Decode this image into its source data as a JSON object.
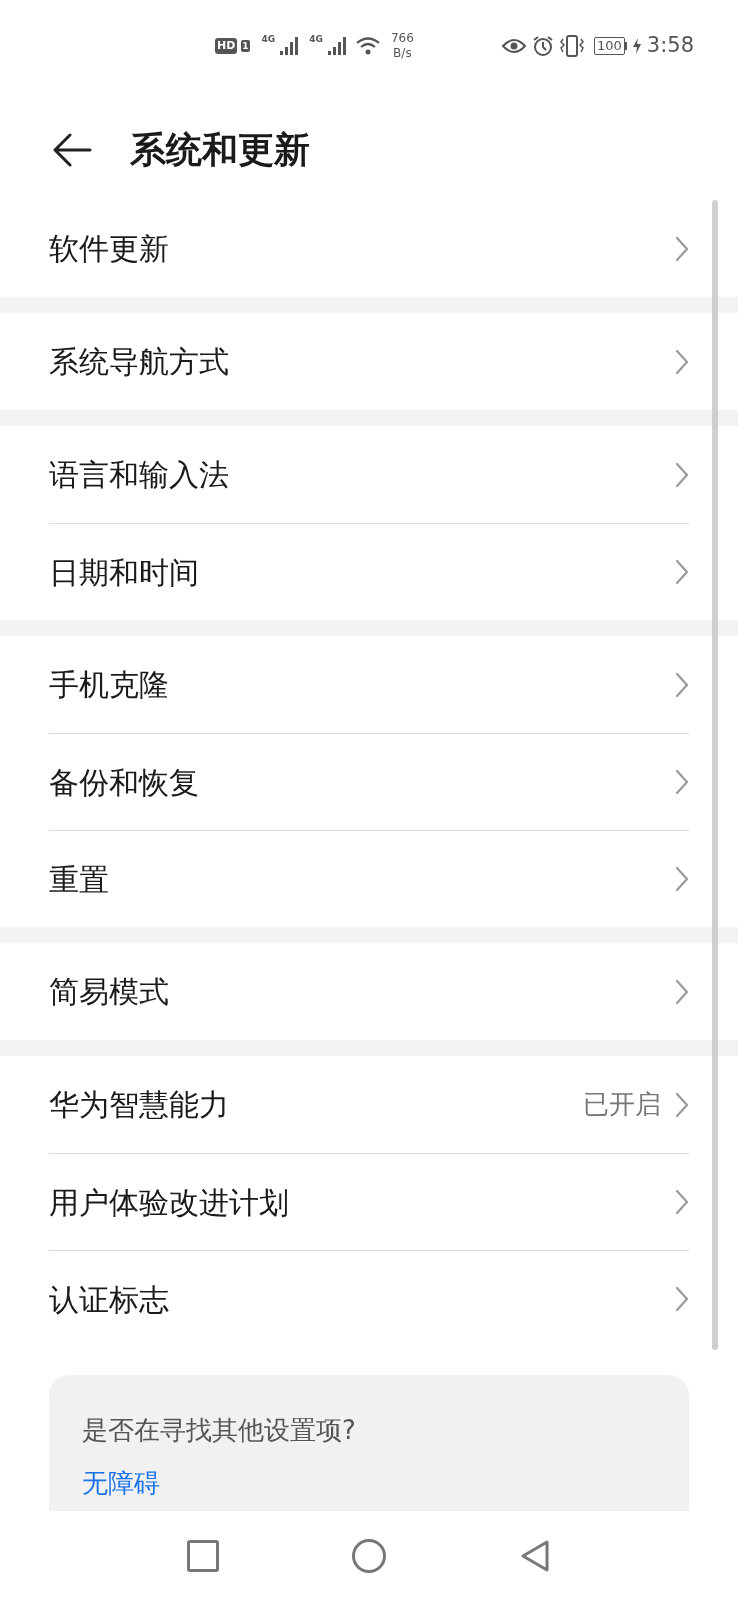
{
  "status_bar": {
    "hd": "HD",
    "sim": "1",
    "network_1": "4G",
    "network_2": "4G",
    "speed_value": "766",
    "speed_unit": "B/s",
    "battery": "100",
    "time": "3:58"
  },
  "header": {
    "title": "系统和更新"
  },
  "groups": [
    {
      "items": [
        {
          "label": "软件更新"
        }
      ]
    },
    {
      "items": [
        {
          "label": "系统导航方式"
        }
      ]
    },
    {
      "items": [
        {
          "label": "语言和输入法"
        },
        {
          "label": "日期和时间"
        }
      ]
    },
    {
      "items": [
        {
          "label": "手机克隆"
        },
        {
          "label": "备份和恢复"
        },
        {
          "label": "重置"
        }
      ]
    },
    {
      "items": [
        {
          "label": "简易模式"
        }
      ]
    },
    {
      "items": [
        {
          "label": "华为智慧能力",
          "value": "已开启"
        },
        {
          "label": "用户体验改进计划"
        },
        {
          "label": "认证标志"
        }
      ]
    }
  ],
  "suggestion": {
    "question": "是否在寻找其他设置项?",
    "link": "无障碍"
  }
}
